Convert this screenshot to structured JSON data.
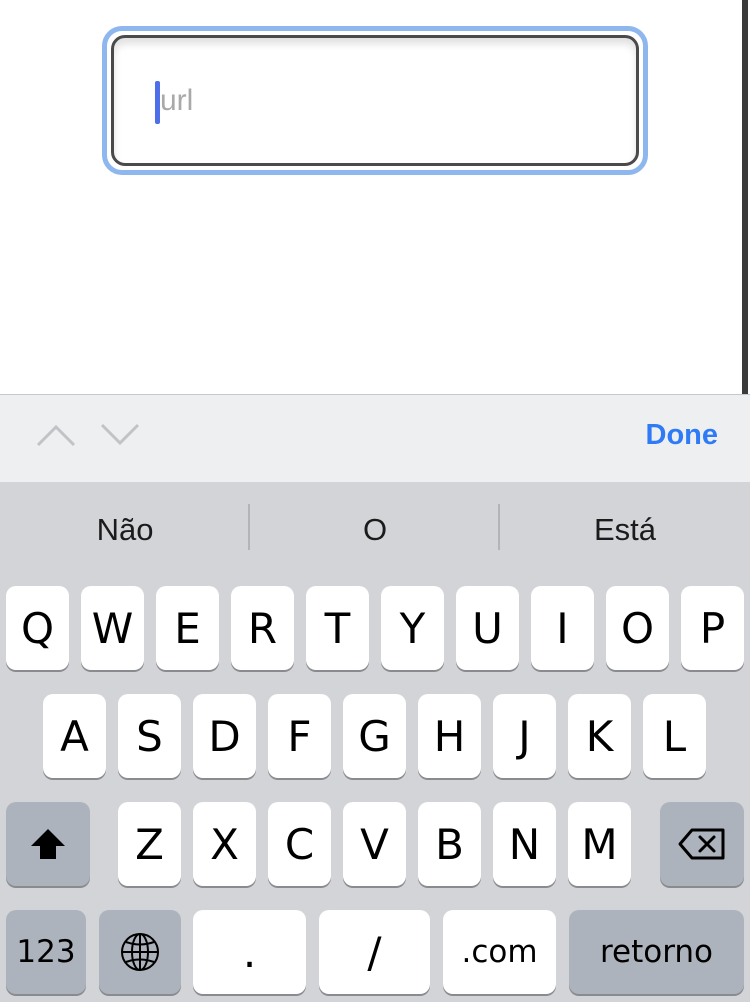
{
  "form": {
    "url_placeholder": "url"
  },
  "accessory_bar": {
    "prev_icon": "chevron-up-icon",
    "next_icon": "chevron-down-icon",
    "done_label": "Done"
  },
  "keyboard": {
    "suggestions": [
      "Não",
      "O",
      "Está"
    ],
    "row1": [
      "Q",
      "W",
      "E",
      "R",
      "T",
      "Y",
      "U",
      "I",
      "O",
      "P"
    ],
    "row2": [
      "A",
      "S",
      "D",
      "F",
      "G",
      "H",
      "J",
      "K",
      "L"
    ],
    "row3": [
      "Z",
      "X",
      "C",
      "V",
      "B",
      "N",
      "M"
    ],
    "shift_icon": "shift-arrow-icon",
    "backspace_icon": "backspace-icon",
    "globe_icon": "globe-icon",
    "numbers_label": "123",
    "dot_label": ".",
    "slash_label": "/",
    "dotcom_label": ".com",
    "return_label": "retorno"
  },
  "colors": {
    "focus_ring": "#8fb7ef",
    "caret": "#4f6ee9",
    "done": "#2f7bf6",
    "keyboard_bg": "#d3d4d8"
  }
}
